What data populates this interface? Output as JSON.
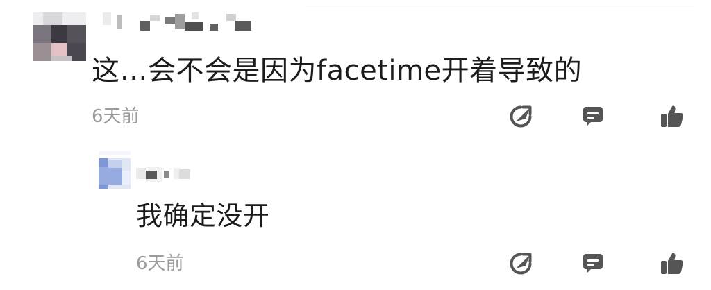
{
  "comments": [
    {
      "text": "这…会不会是因为facetime开着导致的",
      "time": "6天前",
      "actions": [
        "share-icon",
        "reply-icon",
        "like-icon"
      ]
    },
    {
      "text": "我确定没开",
      "time": "6天前",
      "actions": [
        "share-icon",
        "reply-icon",
        "like-icon"
      ]
    }
  ],
  "colors": {
    "text": "#1c1c1c",
    "time": "#9b9b9b",
    "icon": "#555555"
  }
}
